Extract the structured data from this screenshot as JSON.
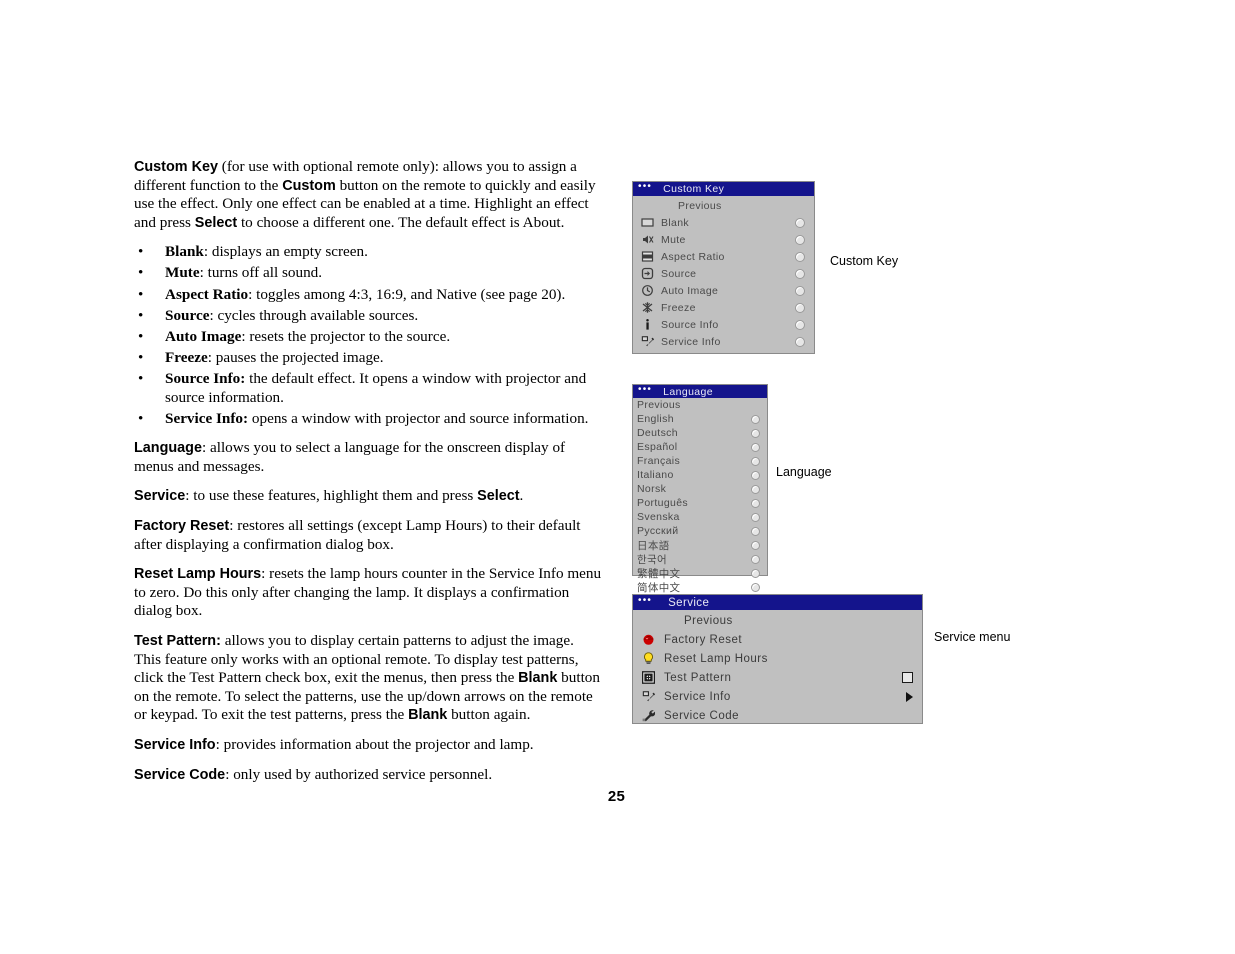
{
  "page": {
    "number": "25"
  },
  "body_text": {
    "intro": {
      "parts": [
        {
          "t": "Custom Key",
          "b": true
        },
        {
          "t": " (for use with optional remote only): allows you to assign a different function to the ",
          "b": false
        },
        {
          "t": "Custom",
          "b": true
        },
        {
          "t": " button on the remote to quickly and easily use the effect. Only one effect can be enabled at a time. Highlight an effect and press ",
          "b": false
        },
        {
          "t": "Select",
          "b": true
        },
        {
          "t": " to choose a different one. The default effect is About.",
          "b": false
        }
      ]
    },
    "bullets": [
      {
        "term": "Blank",
        "rest": ": displays an empty screen."
      },
      {
        "term": "Mute",
        "rest": ": turns off all sound."
      },
      {
        "term": "Aspect Ratio",
        "rest": ": toggles among 4:3, 16:9, and Native (see page 20)."
      },
      {
        "term": "Source",
        "rest": ": cycles through available sources."
      },
      {
        "term": "Auto Image",
        "rest": ": resets the projector to the source."
      },
      {
        "term": "Freeze",
        "rest": ": pauses the projected image."
      },
      {
        "term": "Source Info:",
        "rest": " the default effect. It opens a window with projector and source information."
      },
      {
        "term": "Service Info:",
        "rest": " opens a window with projector and source information."
      }
    ],
    "paragraphs": [
      {
        "parts": [
          {
            "t": "Language",
            "b": true
          },
          {
            "t": ": allows you to select a language for the onscreen display of menus and messages.",
            "b": false
          }
        ]
      },
      {
        "parts": [
          {
            "t": "Service",
            "b": true
          },
          {
            "t": ": to use these features, highlight them and press ",
            "b": false
          },
          {
            "t": "Select",
            "b": true
          },
          {
            "t": ".",
            "b": false
          }
        ]
      },
      {
        "parts": [
          {
            "t": "Factory Reset",
            "b": true
          },
          {
            "t": ": restores all settings (except Lamp Hours) to their default after displaying a confirmation dialog box.",
            "b": false
          }
        ]
      },
      {
        "parts": [
          {
            "t": "Reset Lamp Hours",
            "b": true
          },
          {
            "t": ": resets the lamp hours counter in the Service Info menu to zero. Do this only after changing the lamp. It displays a confirmation dialog box.",
            "b": false
          }
        ]
      },
      {
        "parts": [
          {
            "t": "Test Pattern:",
            "b": true
          },
          {
            "t": " allows you to display certain patterns to adjust the image. This feature only works with an optional remote. To display test patterns, click the Test Pattern check box, exit the menus, then press the ",
            "b": false
          },
          {
            "t": "Blank",
            "b": true
          },
          {
            "t": " button on the remote. To select the patterns, use the up/down arrows on the remote or keypad. To exit the test patterns, press the ",
            "b": false
          },
          {
            "t": "Blank",
            "b": true
          },
          {
            "t": " button again.",
            "b": false
          }
        ]
      },
      {
        "parts": [
          {
            "t": "Service Info",
            "b": true
          },
          {
            "t": ": provides information about the projector and lamp.",
            "b": false
          }
        ]
      },
      {
        "parts": [
          {
            "t": "Service Code",
            "b": true
          },
          {
            "t": ": only used by authorized service personnel.",
            "b": false
          }
        ]
      }
    ]
  },
  "menus": {
    "custom_key": {
      "title": "Custom Key",
      "callout": "Custom Key",
      "title_color": "#14148c",
      "body_color": "#c0c0c0",
      "rows": [
        {
          "label": "Previous",
          "icon": "none",
          "control": "none"
        },
        {
          "label": "Blank",
          "icon": "blank-screen-icon",
          "control": "radio"
        },
        {
          "label": "Mute",
          "icon": "mute-speaker-icon",
          "control": "radio"
        },
        {
          "label": "Aspect Ratio",
          "icon": "aspect-ratio-icon",
          "control": "radio"
        },
        {
          "label": "Source",
          "icon": "source-arrow-icon",
          "control": "radio"
        },
        {
          "label": "Auto Image",
          "icon": "auto-image-icon",
          "control": "radio"
        },
        {
          "label": "Freeze",
          "icon": "freeze-snowflake-icon",
          "control": "radio"
        },
        {
          "label": "Source Info",
          "icon": "info-i-icon",
          "control": "radio"
        },
        {
          "label": "Service Info",
          "icon": "service-wrench-screen-icon",
          "control": "radio"
        }
      ]
    },
    "language": {
      "title": "Language",
      "callout": "Language",
      "title_color": "#14148c",
      "body_color": "#c0c0c0",
      "rows": [
        {
          "label": "Previous",
          "control": "none"
        },
        {
          "label": "English",
          "control": "radio"
        },
        {
          "label": "Deutsch",
          "control": "radio"
        },
        {
          "label": "Español",
          "control": "radio"
        },
        {
          "label": "Français",
          "control": "radio"
        },
        {
          "label": "Italiano",
          "control": "radio"
        },
        {
          "label": "Norsk",
          "control": "radio"
        },
        {
          "label": "Português",
          "control": "radio"
        },
        {
          "label": "Svenska",
          "control": "radio"
        },
        {
          "label": "Русский",
          "control": "radio"
        },
        {
          "label": "日本語",
          "control": "radio"
        },
        {
          "label": "한국어",
          "control": "radio"
        },
        {
          "label": "繁體中文",
          "control": "radio"
        },
        {
          "label": "简体中文",
          "control": "radio"
        }
      ]
    },
    "service": {
      "title": "Service",
      "callout": "Service menu",
      "title_color": "#14148c",
      "body_color": "#c0c0c0",
      "rows": [
        {
          "label": "Previous",
          "icon": "none",
          "control": "none"
        },
        {
          "label": "Factory Reset",
          "icon": "factory-reset-icon",
          "icon_color": "#cc0000",
          "control": "none"
        },
        {
          "label": "Reset Lamp Hours",
          "icon": "lamp-bulb-icon",
          "icon_color": "#ffdd22",
          "control": "none"
        },
        {
          "label": "Test Pattern",
          "icon": "test-pattern-icon",
          "control": "checkbox"
        },
        {
          "label": "Service Info",
          "icon": "service-wrench-screen-icon",
          "control": "arrow"
        },
        {
          "label": "Service Code",
          "icon": "wrench-icon",
          "control": "none"
        }
      ]
    }
  }
}
